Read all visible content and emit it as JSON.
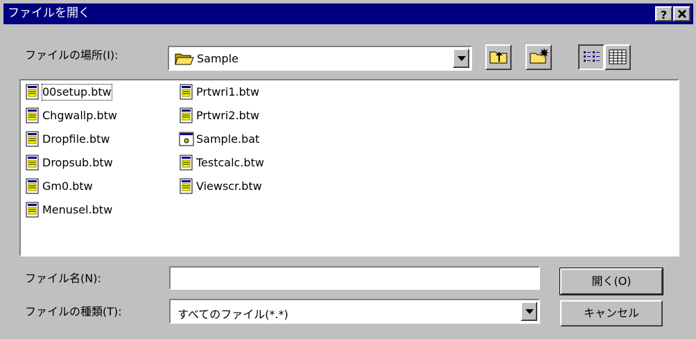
{
  "window": {
    "title": "ファイルを開く",
    "help_button": "?",
    "close_button": "✕"
  },
  "location": {
    "label": "ファイルの場所(I):",
    "value": "Sample"
  },
  "toolbar": {
    "up_icon": "folder-up-icon",
    "new_folder_icon": "new-folder-icon",
    "list_view_icon": "list-view-icon",
    "details_view_icon": "details-view-icon"
  },
  "files": [
    {
      "name": "00setup.btw",
      "icon": "document-icon"
    },
    {
      "name": "Chgwallp.btw",
      "icon": "document-icon"
    },
    {
      "name": "Dropfile.btw",
      "icon": "document-icon"
    },
    {
      "name": "Dropsub.btw",
      "icon": "document-icon"
    },
    {
      "name": "Gm0.btw",
      "icon": "document-icon"
    },
    {
      "name": "Menusel.btw",
      "icon": "document-icon"
    },
    {
      "name": "Prtwri1.btw",
      "icon": "document-icon"
    },
    {
      "name": "Prtwri2.btw",
      "icon": "document-icon"
    },
    {
      "name": "Sample.bat",
      "icon": "batch-file-icon"
    },
    {
      "name": "Testcalc.btw",
      "icon": "document-icon"
    },
    {
      "name": "Viewscr.btw",
      "icon": "document-icon"
    }
  ],
  "filename": {
    "label": "ファイル名(N):",
    "value": ""
  },
  "filetype": {
    "label": "ファイルの種類(T):",
    "value": "すべてのファイル(*.*)"
  },
  "buttons": {
    "open": "開く(O)",
    "cancel": "キャンセル"
  },
  "colors": {
    "face": "#c0c0c0",
    "title": "#000080",
    "window": "#ffffff"
  }
}
